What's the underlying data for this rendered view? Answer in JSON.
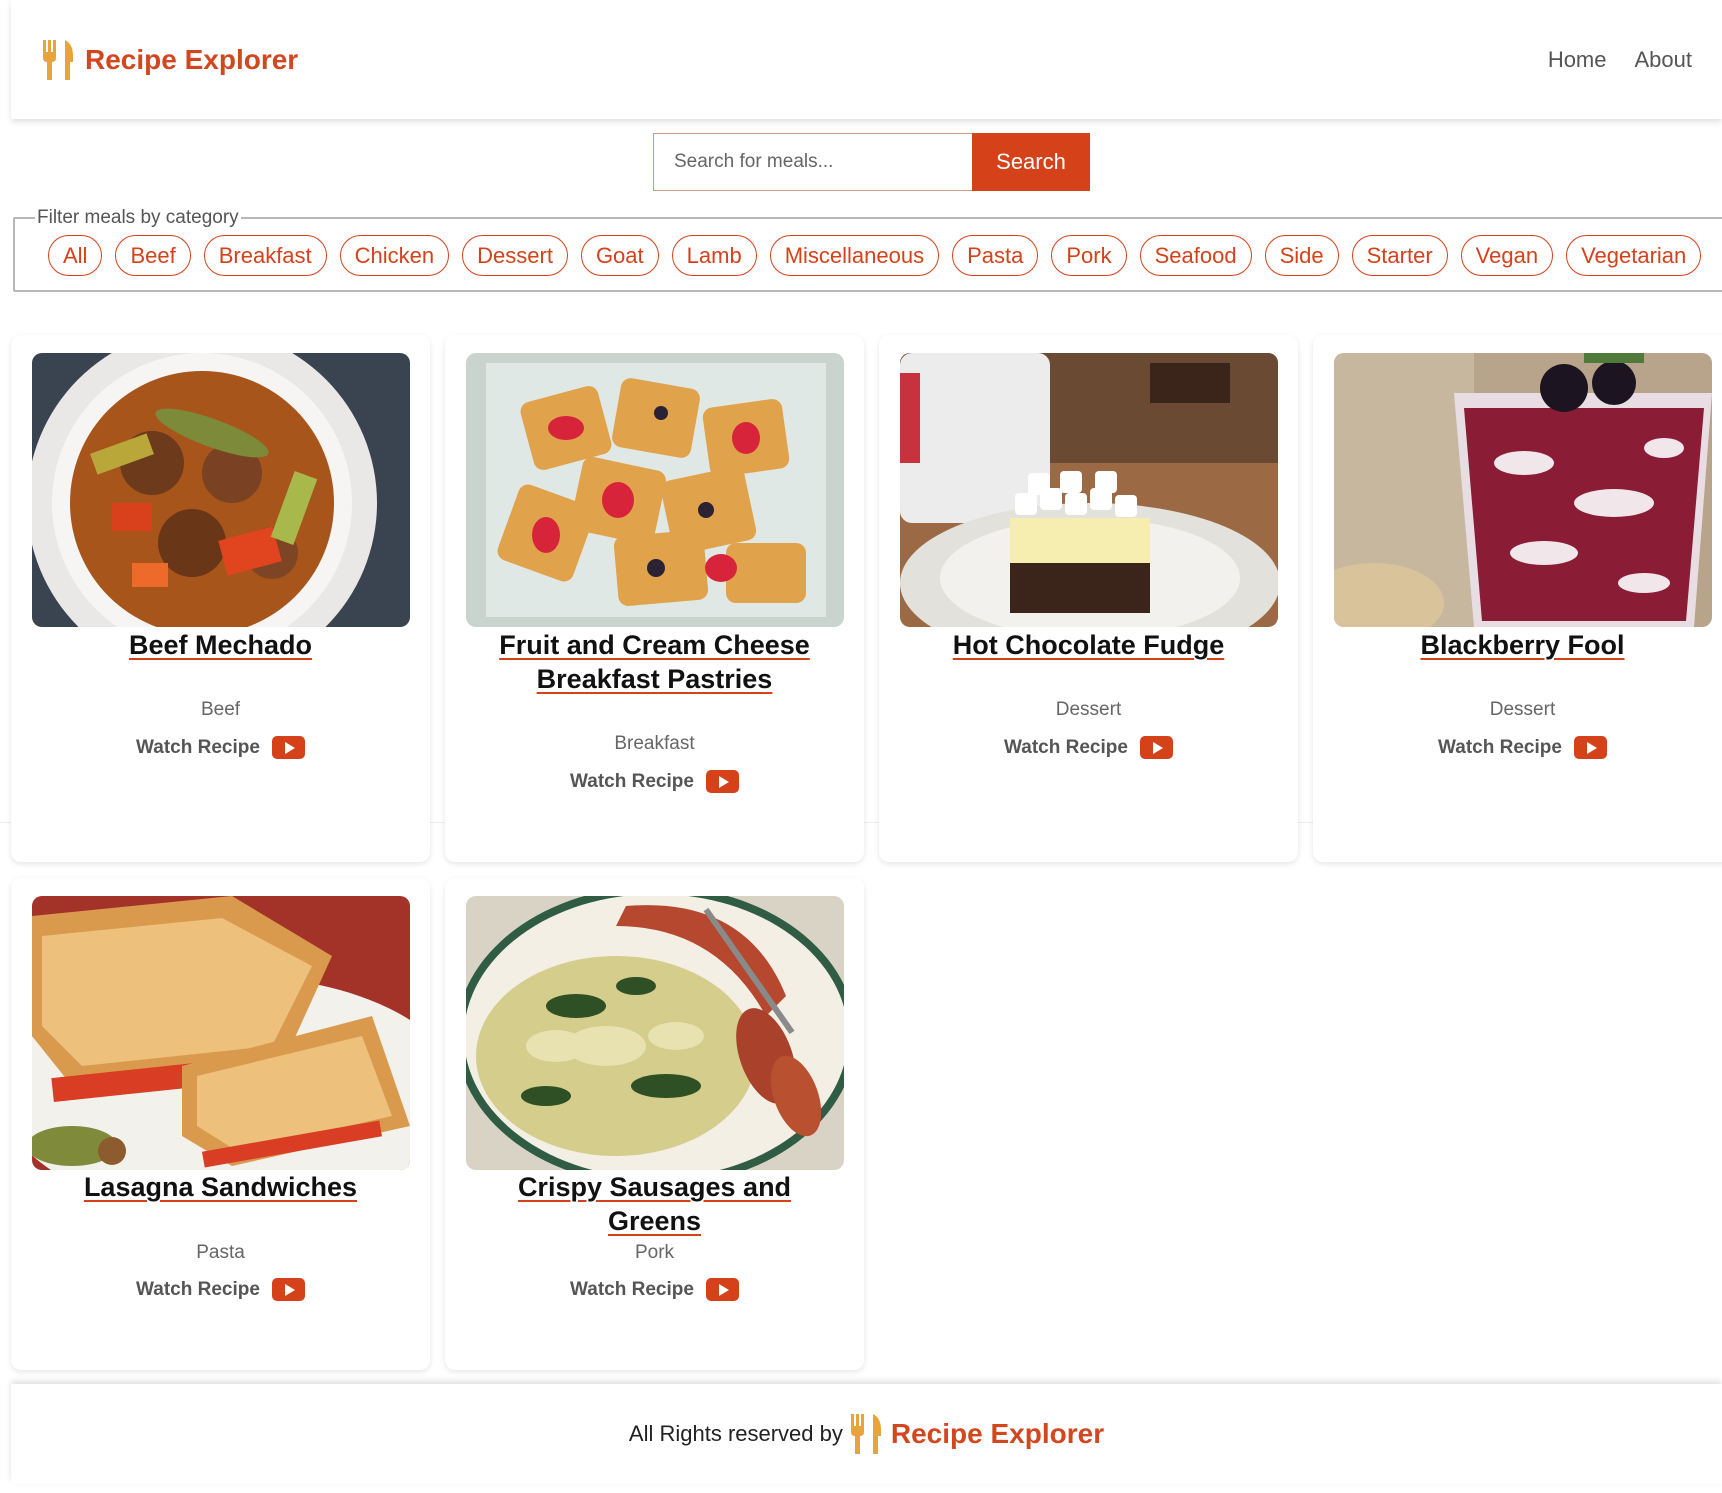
{
  "header": {
    "brand": "Recipe Explorer",
    "nav": [
      "Home",
      "About"
    ]
  },
  "search": {
    "placeholder": "Search for meals...",
    "button": "Search"
  },
  "filter": {
    "legend": "Filter meals by category",
    "categories": [
      "All",
      "Beef",
      "Breakfast",
      "Chicken",
      "Dessert",
      "Goat",
      "Lamb",
      "Miscellaneous",
      "Pasta",
      "Pork",
      "Seafood",
      "Side",
      "Starter",
      "Vegan",
      "Vegetarian"
    ]
  },
  "meals": [
    {
      "title": "Beef Mechado",
      "category": "Beef",
      "action": "Watch Recipe"
    },
    {
      "title": "Fruit and Cream Cheese Breakfast Pastries",
      "category": "Breakfast",
      "action": "Watch Recipe"
    },
    {
      "title": "Hot Chocolate Fudge",
      "category": "Dessert",
      "action": "Watch Recipe"
    },
    {
      "title": "Blackberry Fool",
      "category": "Dessert",
      "action": "Watch Recipe"
    },
    {
      "title": "Lasagna Sandwiches",
      "category": "Pasta",
      "action": "Watch Recipe"
    },
    {
      "title": "Crispy Sausages and Greens",
      "category": "Pork",
      "action": "Watch Recipe"
    }
  ],
  "footer": {
    "text": "All Rights reserved by",
    "brand": "Recipe Explorer"
  },
  "colors": {
    "accent": "#d5421a",
    "brand_icon": "#e8a33c"
  },
  "icons": {
    "brand": "fork-and-knife-icon",
    "video": "youtube-play-icon"
  }
}
